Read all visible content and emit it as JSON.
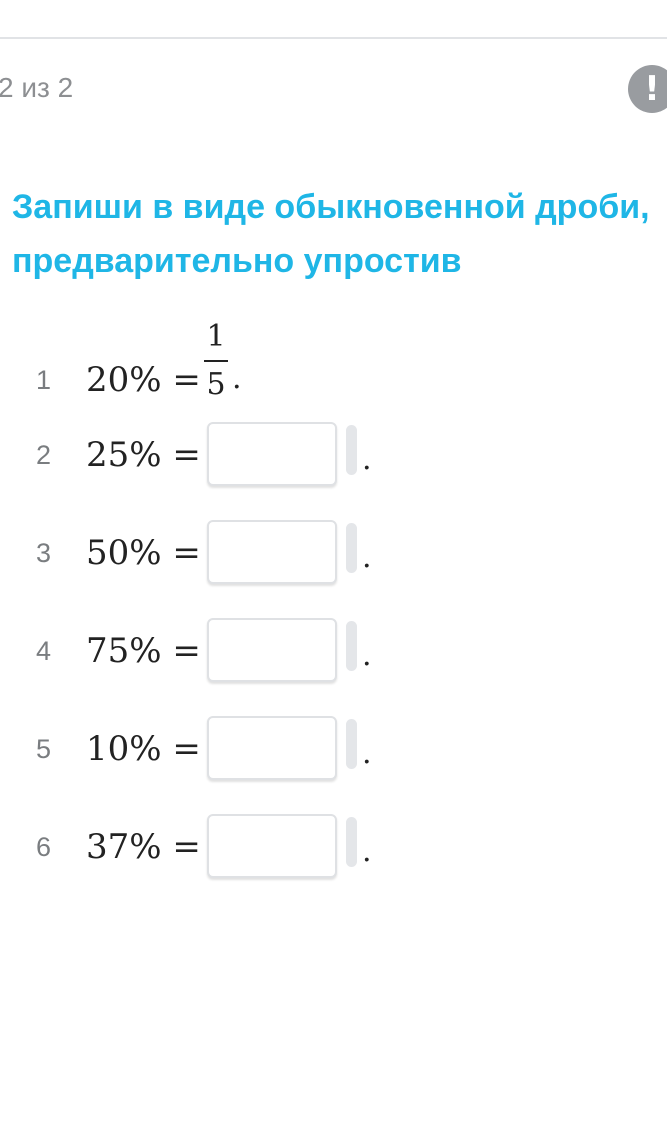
{
  "header": {
    "counter": "2 из 2",
    "report_icon": "exclamation-icon",
    "report_glyph": "!"
  },
  "task": {
    "title": "Запиши в виде обыкновенной дроби, предварительно упростив"
  },
  "problems": [
    {
      "number": "1",
      "expr": "20% =",
      "answer": {
        "numerator": "1",
        "denominator": "5"
      },
      "end": "."
    },
    {
      "number": "2",
      "expr": "25% =",
      "value": "",
      "end": "."
    },
    {
      "number": "3",
      "expr": "50% =",
      "value": "",
      "end": "."
    },
    {
      "number": "4",
      "expr": "75% =",
      "value": "",
      "end": "."
    },
    {
      "number": "5",
      "expr": "10% =",
      "value": "",
      "end": "."
    },
    {
      "number": "6",
      "expr": "37% =",
      "value": "",
      "end": "."
    }
  ],
  "colors": {
    "title": "#1fb6e6",
    "counter": "#8d8f92",
    "report_button": "#999ca0"
  }
}
